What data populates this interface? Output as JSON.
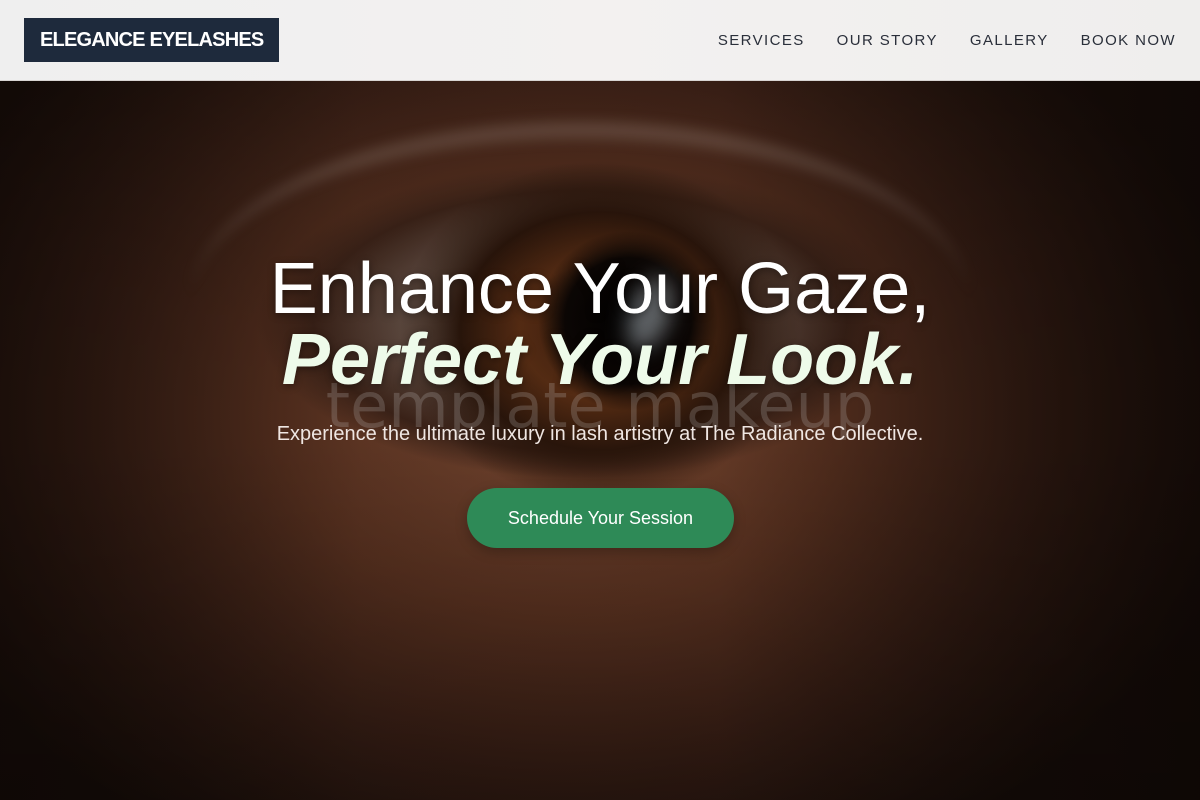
{
  "header": {
    "logo": "ELEGANCE EYELASHES",
    "nav": [
      {
        "label": "SERVICES"
      },
      {
        "label": "OUR STORY"
      },
      {
        "label": "GALLERY"
      },
      {
        "label": "BOOK NOW"
      }
    ]
  },
  "hero": {
    "headline_line1": "Enhance Your Gaze,",
    "headline_line2": "Perfect Your Look.",
    "watermark": "template makeup",
    "subtitle": "Experience the ultimate luxury in lash artistry at The Radiance Collective.",
    "cta_label": "Schedule Your Session",
    "background_image": "close-up-eye-photo"
  },
  "colors": {
    "logo_bg": "#1e2a3c",
    "cta_bg": "#2e8a57",
    "nav_text": "#2a2f3a"
  }
}
